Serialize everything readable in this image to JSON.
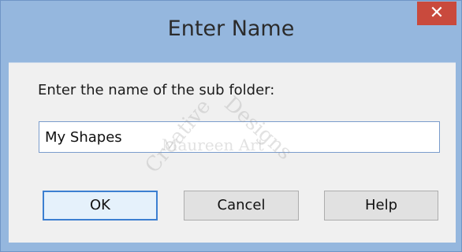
{
  "window": {
    "title": "Enter Name",
    "close_symbol": "✕"
  },
  "prompt": "Enter the name of the sub folder:",
  "name_field": {
    "value": "My Shapes"
  },
  "buttons": {
    "ok": "OK",
    "cancel": "Cancel",
    "help": "Help"
  },
  "watermark": {
    "line1": "Creative",
    "line2": "Designs",
    "line3": "Maureen Art"
  },
  "colors": {
    "frame": "#95b7de",
    "close_button": "#c94a3d",
    "default_button_border": "#3c7fd1",
    "client_background": "#f0f0f0"
  },
  "icons": {
    "close": "close-icon"
  }
}
